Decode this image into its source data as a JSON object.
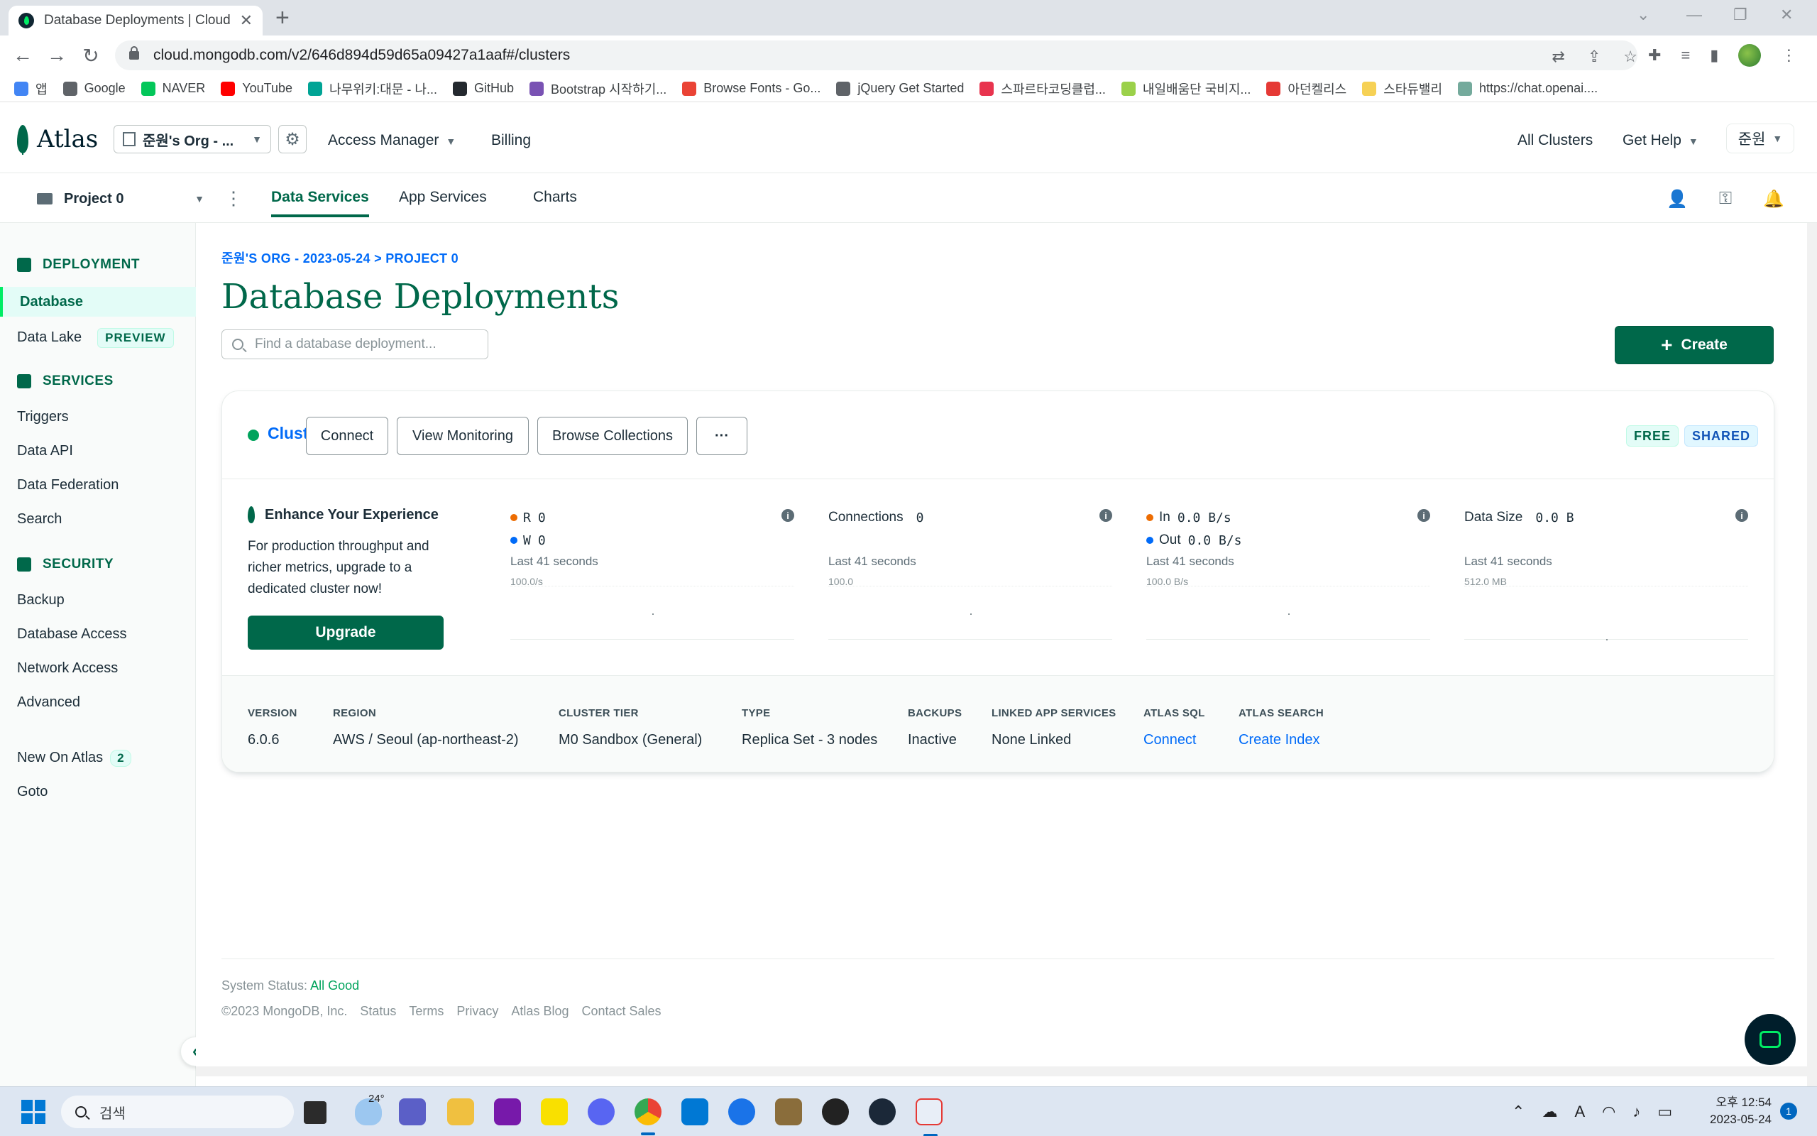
{
  "browser": {
    "tab_title": "Database Deployments | Cloud",
    "url": "cloud.mongodb.com/v2/646d894d59d65a09427a1aaf#/clusters",
    "bookmarks": [
      {
        "label": "앱",
        "color": "#4285f4"
      },
      {
        "label": "Google",
        "color": "#5f6368"
      },
      {
        "label": "NAVER",
        "color": "#03c75a"
      },
      {
        "label": "YouTube",
        "color": "#ff0000"
      },
      {
        "label": "나무위키:대문 - 나...",
        "color": "#00a495"
      },
      {
        "label": "GitHub",
        "color": "#24292f"
      },
      {
        "label": "Bootstrap 시작하기...",
        "color": "#7952b3"
      },
      {
        "label": "Browse Fonts - Go...",
        "color": "#ea4335"
      },
      {
        "label": "jQuery Get Started",
        "color": "#5f6368"
      },
      {
        "label": "스파르타코딩클럽...",
        "color": "#e8344e"
      },
      {
        "label": "내일배움단 국비지...",
        "color": "#9bd14a"
      },
      {
        "label": "아던켈리스",
        "color": "#e53935"
      },
      {
        "label": "스타듀밸리",
        "color": "#f6d155"
      },
      {
        "label": "https://chat.openai....",
        "color": "#74aa9c"
      }
    ]
  },
  "header": {
    "logo_text": "Atlas",
    "org_name": "준원's Org - ...",
    "access_manager": "Access Manager",
    "billing": "Billing",
    "all_clusters": "All Clusters",
    "get_help": "Get Help",
    "user": "준원"
  },
  "project_bar": {
    "project_name": "Project 0",
    "tabs": [
      {
        "label": "Data Services",
        "active": true
      },
      {
        "label": "App Services",
        "active": false
      },
      {
        "label": "Charts",
        "active": false
      }
    ]
  },
  "sidebar": {
    "deployment_heading": "DEPLOYMENT",
    "database": "Database",
    "data_lake": "Data Lake",
    "preview_badge": "PREVIEW",
    "services_heading": "SERVICES",
    "triggers": "Triggers",
    "data_api": "Data API",
    "data_federation": "Data Federation",
    "search": "Search",
    "security_heading": "SECURITY",
    "backup": "Backup",
    "database_access": "Database Access",
    "network_access": "Network Access",
    "advanced": "Advanced",
    "new_on_atlas": "New On Atlas",
    "new_on_atlas_count": "2",
    "goto": "Goto"
  },
  "main": {
    "breadcrumb": "준원'S ORG - 2023-05-24 > PROJECT 0",
    "title": "Database Deployments",
    "search_placeholder": "Find a database deployment...",
    "create_label": "Create"
  },
  "cluster": {
    "name": "Cluster0",
    "status_color": "#00a35c",
    "buttons": {
      "connect": "Connect",
      "view_monitoring": "View Monitoring",
      "browse_collections": "Browse Collections",
      "more": "···"
    },
    "badges": {
      "free": "FREE",
      "shared": "SHARED"
    },
    "upgrade": {
      "title": "Enhance Your Experience",
      "text": "For production throughput and richer metrics, upgrade to a dedicated cluster now!",
      "button": "Upgrade"
    },
    "metrics": {
      "rw": {
        "r_label": "R",
        "r_value": "0",
        "w_label": "W",
        "w_value": "0",
        "sub": "Last 41 seconds",
        "scale": "100.0/s"
      },
      "connections": {
        "label": "Connections",
        "value": "0",
        "sub": "Last 41 seconds",
        "scale": "100.0"
      },
      "network": {
        "in_label": "In",
        "in_value": "0.0 B/s",
        "out_label": "Out",
        "out_value": "0.0 B/s",
        "sub": "Last 41 seconds",
        "scale": "100.0 B/s"
      },
      "data_size": {
        "label": "Data Size",
        "value": "0.0 B",
        "sub": "Last 41 seconds",
        "scale": "512.0 MB"
      }
    },
    "specs": {
      "version": {
        "key": "VERSION",
        "value": "6.0.6"
      },
      "region": {
        "key": "REGION",
        "value": "AWS / Seoul (ap-northeast-2)"
      },
      "tier": {
        "key": "CLUSTER TIER",
        "value": "M0 Sandbox (General)"
      },
      "type": {
        "key": "TYPE",
        "value": "Replica Set - 3 nodes"
      },
      "backups": {
        "key": "BACKUPS",
        "value": "Inactive"
      },
      "linked_app": {
        "key": "LINKED APP SERVICES",
        "value": "None Linked"
      },
      "atlas_sql": {
        "key": "ATLAS SQL",
        "value": "Connect"
      },
      "atlas_search": {
        "key": "ATLAS SEARCH",
        "value": "Create Index"
      }
    }
  },
  "footer": {
    "status_label": "System Status:",
    "status_value": "All Good",
    "copyright": "©2023 MongoDB, Inc.",
    "links": [
      "Status",
      "Terms",
      "Privacy",
      "Atlas Blog",
      "Contact Sales"
    ]
  },
  "taskbar": {
    "search_placeholder": "검색",
    "temperature": "24°",
    "time": "오후 12:54",
    "date": "2023-05-24",
    "notification_count": "1"
  },
  "colors": {
    "brand_green": "#00684a",
    "accent_green": "#00ed64",
    "link_blue": "#016bf8",
    "read_dot": "#ed6c02",
    "write_dot": "#016bf8"
  }
}
